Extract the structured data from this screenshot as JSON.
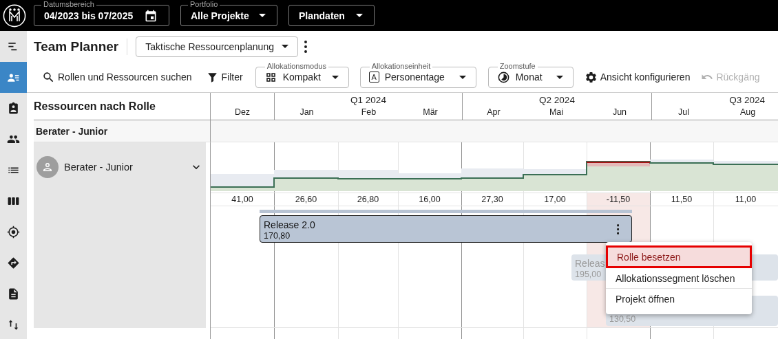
{
  "topbar": {
    "fields": [
      {
        "kind": "date",
        "label": "Datumsbereich",
        "value": "04/2023 bis 07/2025"
      },
      {
        "kind": "select",
        "label": "Portfolio",
        "value": "Alle Projekte"
      },
      {
        "kind": "select",
        "value": "Plandaten"
      }
    ]
  },
  "sidebar": {
    "items": [
      {
        "kind": "menu",
        "selected": false
      },
      {
        "kind": "resources",
        "selected": true
      },
      {
        "kind": "assignments",
        "selected": false
      },
      {
        "kind": "teams",
        "selected": false
      },
      {
        "kind": "list",
        "selected": false
      },
      {
        "kind": "board",
        "selected": false
      },
      {
        "kind": "target",
        "selected": false
      },
      {
        "kind": "route",
        "selected": false
      },
      {
        "kind": "document",
        "selected": false
      },
      {
        "kind": "sort",
        "selected": false
      }
    ]
  },
  "header": {
    "title": "Team Planner",
    "view": "Taktische Ressourcenplanung"
  },
  "toolbar": {
    "items": [
      {
        "kind": "search",
        "label": "Rollen und Ressourcen suchen",
        "disabled": false
      },
      {
        "kind": "filter",
        "label": "Filter",
        "disabled": false
      },
      {
        "kind": "mode",
        "label": "Allokationsmodus",
        "value": "Kompakt",
        "disabled": false
      },
      {
        "kind": "unit",
        "glyph": "A",
        "label": "Allokationseinheit",
        "value": "Personentage",
        "disabled": false
      },
      {
        "kind": "zoom",
        "label": "Zoomstufe",
        "value": "Monat",
        "disabled": false
      },
      {
        "kind": "settings",
        "label": "Ansicht konfigurieren",
        "disabled": false
      },
      {
        "kind": "undo",
        "label": "Rückgäng",
        "disabled": true
      }
    ]
  },
  "planner": {
    "heading": "Ressourcen nach Rolle",
    "quarters": [
      {
        "months": [
          "Dez"
        ]
      },
      {
        "label": "Q1 2024",
        "months": [
          "Jan",
          "Feb",
          "Mär"
        ]
      },
      {
        "label": "Q2 2024",
        "months": [
          "Apr",
          "Mai",
          "Jun"
        ]
      },
      {
        "label": "Q3 2024",
        "months": [
          "Jul",
          "Aug"
        ]
      }
    ],
    "groups": [
      {
        "name": "Berater - Junior",
        "resources": [
          {
            "name": "Berater - Junior",
            "cells": [
              {
                "value": "41,00",
                "overbooked": false
              },
              {
                "value": "26,60",
                "overbooked": false
              },
              {
                "value": "26,80",
                "overbooked": false
              },
              {
                "value": "16,00",
                "overbooked": false
              },
              {
                "value": "27,30",
                "overbooked": false
              },
              {
                "value": "17,00",
                "overbooked": false
              },
              {
                "value": "-11,50",
                "overbooked": true
              },
              {
                "value": "11,50",
                "overbooked": false
              },
              {
                "value": "11,00",
                "overbooked": false
              }
            ],
            "allocations": [
              {
                "title": "Release 2.0",
                "amount": "170,80",
                "selected": true
              },
              {
                "title": "Releas",
                "amount": "195,00",
                "selected": false
              },
              {
                "amount": "130,50",
                "selected": false
              }
            ]
          }
        ]
      }
    ]
  },
  "context_menu": {
    "items": [
      {
        "label": "Rolle besetzen",
        "selected": true
      },
      {
        "label": "Allokationssegment löschen",
        "selected": false
      },
      {
        "label": "Projekt öffnen",
        "selected": false
      }
    ]
  }
}
